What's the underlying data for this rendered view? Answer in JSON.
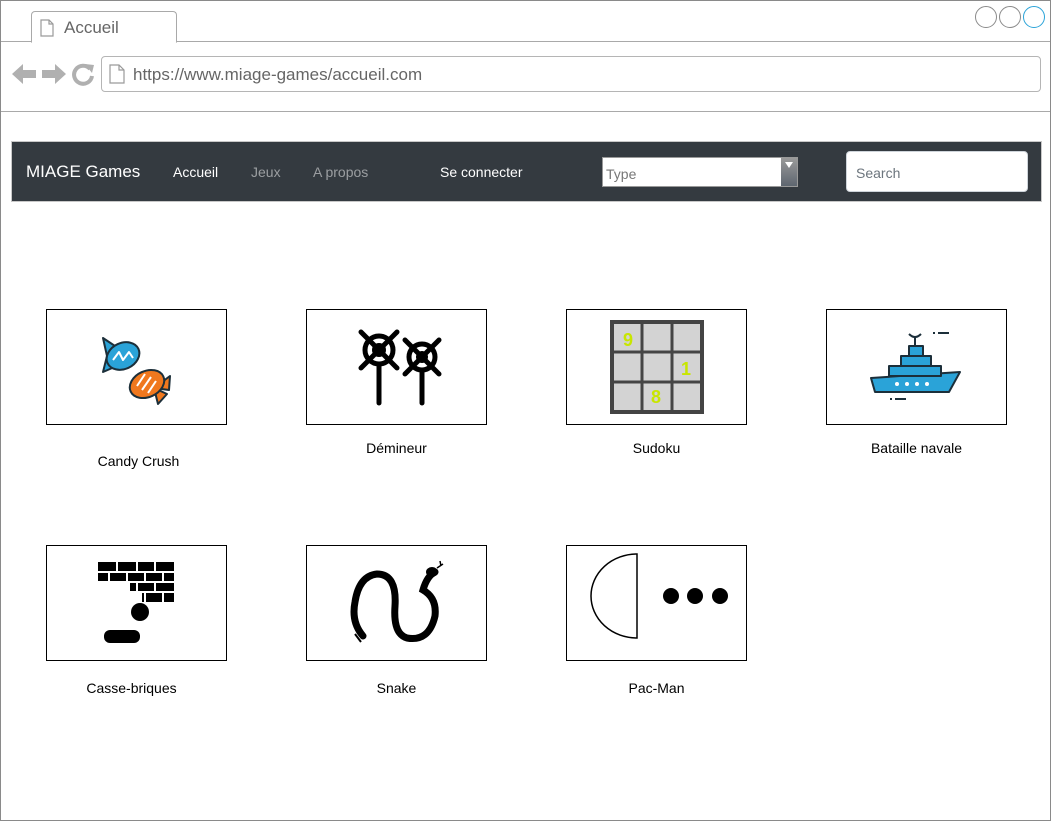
{
  "browser": {
    "tab_title": "Accueil",
    "url": "https://www.miage-games/accueil.com",
    "icons": [
      "back-arrow-icon",
      "forward-arrow-icon",
      "reload-icon",
      "document-icon"
    ]
  },
  "navbar": {
    "brand": "MIAGE Games",
    "links": [
      {
        "label": "Accueil",
        "active": true
      },
      {
        "label": "Jeux",
        "active": false
      },
      {
        "label": "A propos",
        "active": false
      }
    ],
    "login": "Se connecter",
    "type_select": {
      "placeholder": "Type"
    },
    "search": {
      "placeholder": "Search"
    }
  },
  "games": [
    {
      "label": "Candy Crush",
      "icon": "candy-icon"
    },
    {
      "label": "Démineur",
      "icon": "mines-icon"
    },
    {
      "label": "Sudoku",
      "icon": "sudoku-grid-icon"
    },
    {
      "label": "Bataille navale",
      "icon": "battleship-icon"
    },
    {
      "label": "Casse-briques",
      "icon": "brick-breaker-icon"
    },
    {
      "label": "Snake",
      "icon": "snake-icon"
    },
    {
      "label": "Pac-Man",
      "icon": "pacman-icon"
    }
  ],
  "sudoku_digits": [
    "9",
    "1",
    "8"
  ],
  "colors": {
    "navbar": "#343a40",
    "accent": "#2aa3d8",
    "sudoku_digit": "#c8e600"
  }
}
